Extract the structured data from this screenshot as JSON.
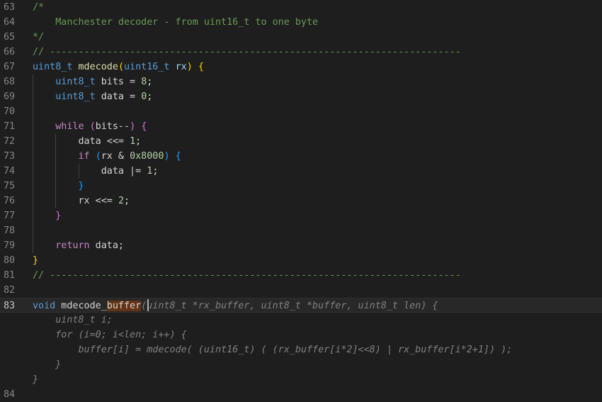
{
  "colors": {
    "background": "#1e1e1e",
    "comment": "#6a9955",
    "type": "#569cd6",
    "function": "#dcdcaa",
    "keyword": "#c586c0",
    "number": "#b5cea8",
    "word_highlight": "#623315",
    "ghost_text": "#808080"
  },
  "editor": {
    "cursor_line": "83",
    "lines": [
      {
        "num": "63",
        "tokens": [
          {
            "t": "/*",
            "c": "comment"
          }
        ]
      },
      {
        "num": "64",
        "tokens": [
          {
            "t": "    Manchester decoder - from uint16_t to one byte",
            "c": "comment"
          }
        ]
      },
      {
        "num": "65",
        "tokens": [
          {
            "t": "*/",
            "c": "comment"
          }
        ]
      },
      {
        "num": "66",
        "tokens": [
          {
            "t": "// ------------------------------------------------------------------------",
            "c": "comment"
          }
        ]
      },
      {
        "num": "67",
        "tokens": [
          {
            "t": "uint8_t",
            "c": "type"
          },
          {
            "t": " ",
            "c": "text"
          },
          {
            "t": "mdecode",
            "c": "func"
          },
          {
            "t": "(",
            "c": "brace1"
          },
          {
            "t": "uint16_t",
            "c": "type"
          },
          {
            "t": " ",
            "c": "text"
          },
          {
            "t": "rx",
            "c": "var"
          },
          {
            "t": ")",
            "c": "brace1"
          },
          {
            "t": " ",
            "c": "text"
          },
          {
            "t": "{",
            "c": "brace1"
          }
        ]
      },
      {
        "num": "68",
        "tokens": [
          {
            "t": "    ",
            "c": "text"
          },
          {
            "t": "uint8_t",
            "c": "type"
          },
          {
            "t": " bits = ",
            "c": "text"
          },
          {
            "t": "8",
            "c": "num"
          },
          {
            "t": ";",
            "c": "text"
          }
        ]
      },
      {
        "num": "69",
        "tokens": [
          {
            "t": "    ",
            "c": "text"
          },
          {
            "t": "uint8_t",
            "c": "type"
          },
          {
            "t": " data = ",
            "c": "text"
          },
          {
            "t": "0",
            "c": "num"
          },
          {
            "t": ";",
            "c": "text"
          }
        ]
      },
      {
        "num": "70",
        "tokens": []
      },
      {
        "num": "71",
        "tokens": [
          {
            "t": "    ",
            "c": "text"
          },
          {
            "t": "while",
            "c": "kw"
          },
          {
            "t": " ",
            "c": "text"
          },
          {
            "t": "(",
            "c": "brace2"
          },
          {
            "t": "bits--",
            "c": "text"
          },
          {
            "t": ")",
            "c": "brace2"
          },
          {
            "t": " ",
            "c": "text"
          },
          {
            "t": "{",
            "c": "brace2"
          }
        ]
      },
      {
        "num": "72",
        "tokens": [
          {
            "t": "        data <<= ",
            "c": "text"
          },
          {
            "t": "1",
            "c": "num"
          },
          {
            "t": ";",
            "c": "text"
          }
        ]
      },
      {
        "num": "73",
        "tokens": [
          {
            "t": "        ",
            "c": "text"
          },
          {
            "t": "if",
            "c": "kw"
          },
          {
            "t": " ",
            "c": "text"
          },
          {
            "t": "(",
            "c": "brace3"
          },
          {
            "t": "rx & ",
            "c": "text"
          },
          {
            "t": "0x8000",
            "c": "num"
          },
          {
            "t": ")",
            "c": "brace3"
          },
          {
            "t": " ",
            "c": "text"
          },
          {
            "t": "{",
            "c": "brace3"
          }
        ]
      },
      {
        "num": "74",
        "tokens": [
          {
            "t": "            data |= ",
            "c": "text"
          },
          {
            "t": "1",
            "c": "num"
          },
          {
            "t": ";",
            "c": "text"
          }
        ]
      },
      {
        "num": "75",
        "tokens": [
          {
            "t": "        ",
            "c": "text"
          },
          {
            "t": "}",
            "c": "brace3"
          }
        ]
      },
      {
        "num": "76",
        "tokens": [
          {
            "t": "        rx <<= ",
            "c": "text"
          },
          {
            "t": "2",
            "c": "num"
          },
          {
            "t": ";",
            "c": "text"
          }
        ]
      },
      {
        "num": "77",
        "tokens": [
          {
            "t": "    ",
            "c": "text"
          },
          {
            "t": "}",
            "c": "brace2"
          }
        ]
      },
      {
        "num": "78",
        "tokens": []
      },
      {
        "num": "79",
        "tokens": [
          {
            "t": "    ",
            "c": "text"
          },
          {
            "t": "return",
            "c": "kw"
          },
          {
            "t": " data;",
            "c": "text"
          }
        ]
      },
      {
        "num": "80",
        "tokens": [
          {
            "t": "}",
            "c": "brace1"
          }
        ]
      },
      {
        "num": "81",
        "tokens": [
          {
            "t": "// ------------------------------------------------------------------------",
            "c": "comment"
          }
        ]
      },
      {
        "num": "82",
        "tokens": []
      },
      {
        "num": "83",
        "tokens": [
          {
            "t": "void",
            "c": "type"
          },
          {
            "t": " mdecode_",
            "c": "text"
          },
          {
            "t": "buffer",
            "c": "hl"
          },
          {
            "t": "(uint8_t *rx_buffer, uint8_t *buffer, uint8_t len) {",
            "c": "dim"
          }
        ]
      },
      {
        "num": "",
        "tokens": [
          {
            "t": "    uint8_t i;",
            "c": "dim"
          }
        ]
      },
      {
        "num": "",
        "tokens": [
          {
            "t": "    for (i=0; i<len; i++) {",
            "c": "dim"
          }
        ]
      },
      {
        "num": "",
        "tokens": [
          {
            "t": "        buffer[i] = mdecode( (uint16_t) ( (rx_buffer[i*2]<<8) | rx_buffer[i*2+1]) );",
            "c": "dim"
          }
        ]
      },
      {
        "num": "",
        "tokens": [
          {
            "t": "    }",
            "c": "dim"
          }
        ]
      },
      {
        "num": "",
        "tokens": [
          {
            "t": "}",
            "c": "dim"
          }
        ]
      },
      {
        "num": "84",
        "tokens": []
      }
    ]
  }
}
